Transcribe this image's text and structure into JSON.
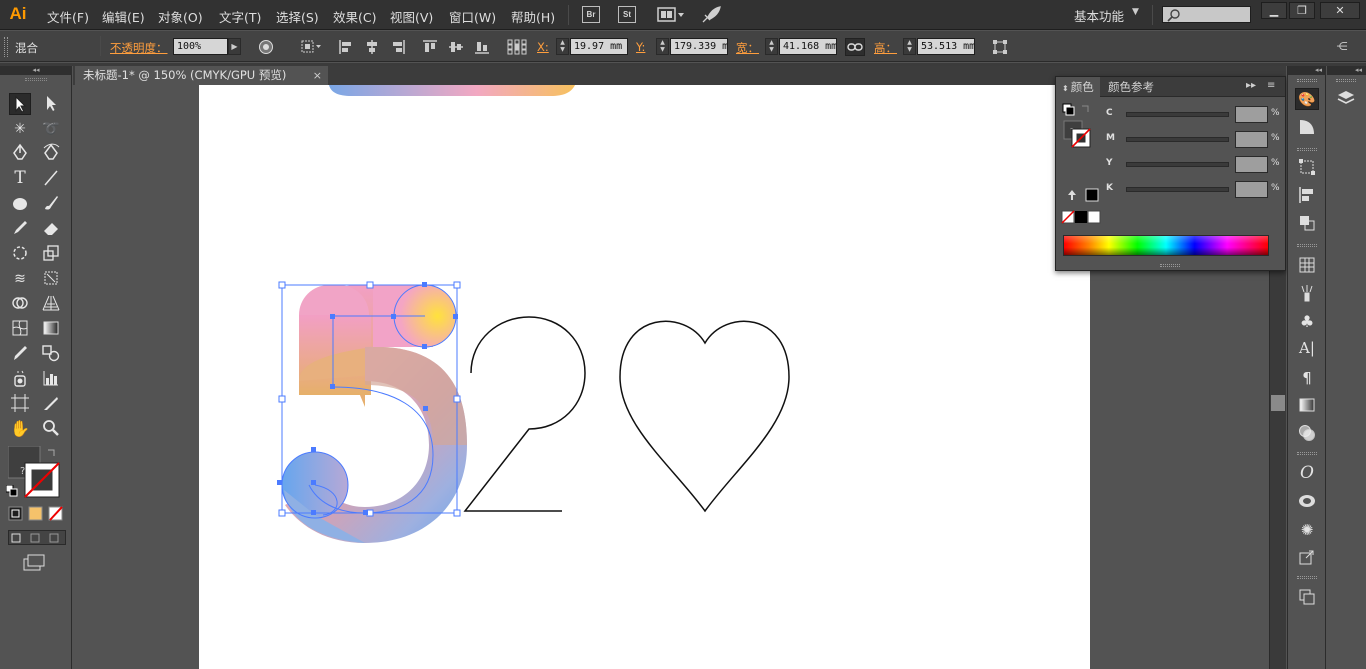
{
  "app": {
    "logo": "Ai",
    "workspace": "基本功能",
    "accent": "#ff9a00"
  },
  "menu": [
    "文件(F)",
    "编辑(E)",
    "对象(O)",
    "文字(T)",
    "选择(S)",
    "效果(C)",
    "视图(V)",
    "窗口(W)",
    "帮助(H)"
  ],
  "app_buttons": {
    "bridge": "Br",
    "stock": "St"
  },
  "control": {
    "mode_label": "混合",
    "opacity_label": "不透明度：",
    "opacity_value": "100%",
    "x_label": "X:",
    "x_value": "19.97 mm",
    "y_label": "Y:",
    "y_value": "179.339 m",
    "w_label": "宽：",
    "w_value": "41.168 mm",
    "h_label": "高：",
    "h_value": "53.513 mm"
  },
  "document": {
    "tab_title": "未标题-1* @ 150% (CMYK/GPU 预览)",
    "close": "×"
  },
  "color_panel": {
    "tab_active": "颜色",
    "tab_inactive": "颜色参考",
    "sliders": [
      {
        "label": "C",
        "value": ""
      },
      {
        "label": "M",
        "value": ""
      },
      {
        "label": "Y",
        "value": ""
      },
      {
        "label": "K",
        "value": ""
      }
    ],
    "percent_sign": "%"
  },
  "icons": {
    "tools": [
      "selection-tool",
      "direct-selection-tool",
      "magic-wand-tool",
      "lasso-tool",
      "pen-tool",
      "curvature-tool",
      "type-tool",
      "line-segment-tool",
      "ellipse-tool",
      "paintbrush-tool",
      "pencil-tool",
      "eraser-tool",
      "rotate-tool",
      "scale-tool",
      "width-tool",
      "free-transform-tool",
      "shape-builder-tool",
      "perspective-grid-tool",
      "mesh-tool",
      "gradient-tool",
      "eyedropper-tool",
      "blend-tool",
      "symbol-sprayer-tool",
      "column-graph-tool",
      "artboard-tool",
      "slice-tool",
      "hand-tool",
      "zoom-tool"
    ],
    "dock": [
      "color-icon",
      "color-guide-icon",
      "transform-icon",
      "align-icon",
      "pathfinder-icon",
      "swatches-icon",
      "brushes-icon",
      "symbols-icon",
      "character-icon",
      "paragraph-icon",
      "gradient-icon",
      "transparency-icon",
      "opentype-icon",
      "cc-libraries-icon",
      "appearance-icon",
      "export-icon",
      "artboards-icon",
      "layers-icon"
    ]
  },
  "colors": {
    "gradient_pink": "#f0a2c8",
    "gradient_yellow": "#f5d050",
    "gradient_blue": "#6fa8ea",
    "selection_blue": "#4b7bff"
  }
}
